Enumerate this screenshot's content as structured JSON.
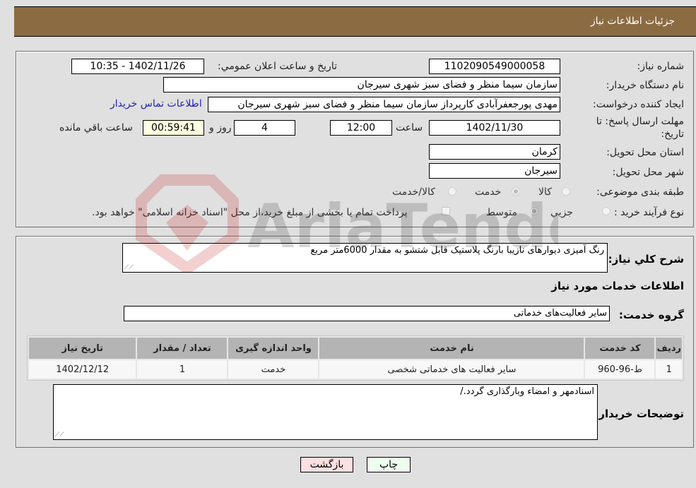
{
  "header": {
    "title": "جزئیات اطلاعات نیاز"
  },
  "details": {
    "need_number_label": "شماره نیاز:",
    "need_number": "1102090549000058",
    "announce_label": "تاریخ و ساعت اعلان عمومي:",
    "announce_value": "1402/11/26 - 10:35",
    "buyer_org_label": "نام دستگاه خریدار:",
    "buyer_org": "سازمان سیما منظر و فضای سبز شهری سیرجان",
    "creator_label": "ایجاد کننده درخواست:",
    "creator": "مهدی پورجعفرآبادی کارپرداز سازمان سیما منظر و فضای سبز شهری سیرجان",
    "contact_link": "اطلاعات تماس خریدار",
    "deadline_label_line1": "مهلت ارسال پاسخ: تا",
    "deadline_label_line2": "تاریخ:",
    "deadline_date": "1402/11/30",
    "time_label": "ساعت",
    "deadline_time": "12:00",
    "days_value": "4",
    "days_label": "روز و",
    "remaining_time": "00:59:41",
    "remaining_label": "ساعت باقي مانده",
    "province_label": "استان محل تحویل:",
    "province": "کرمان",
    "city_label": "شهر محل تحویل:",
    "city": "سیرجان",
    "category_label": "طبقه بندی موضوعی:",
    "category_options": [
      {
        "label": "کالا",
        "selected": false
      },
      {
        "label": "خدمت",
        "selected": true
      },
      {
        "label": "کالا/خدمت",
        "selected": false
      }
    ],
    "process_label": "نوع فرآیند خرید :",
    "process_options": [
      {
        "label": "جزيي",
        "selected": false
      },
      {
        "label": "متوسط",
        "selected": true
      }
    ],
    "treasury_note": "پرداخت تمام یا بخشی از مبلغ خرید،از محل \"اسناد خزانه اسلامی\" خواهد بود.",
    "treasury_checked": false
  },
  "description": {
    "label": "شرح کلي نياز:",
    "value": "رنگ آمیزی دیوارهای نازیبا بارنگ پلاستیک قابل شتشو به مقدار 6000متر مربع"
  },
  "services": {
    "section_title": "اطلاعات خدمات مورد نیاز",
    "group_label": "گروه خدمت:",
    "group_value": "سایر فعالیت‌های خدماتی",
    "columns": [
      "ردیف",
      "کد خدمت",
      "نام خدمت",
      "واحد اندازه گیری",
      "تعداد / مقدار",
      "تاریخ نیاز"
    ],
    "rows": [
      [
        "1",
        "ط-96-960",
        "سایر فعالیت های خدماتی شخصی",
        "خدمت",
        "1",
        "1402/12/12"
      ]
    ]
  },
  "buyer_notes": {
    "label": "توضیحات خریدار:",
    "value": "اسنادمهر و امضاء وبارگذاری گردد./"
  },
  "buttons": {
    "print": "چاپ",
    "back": "بازگشت"
  },
  "watermark": {
    "text": "AriaTender.neT"
  }
}
